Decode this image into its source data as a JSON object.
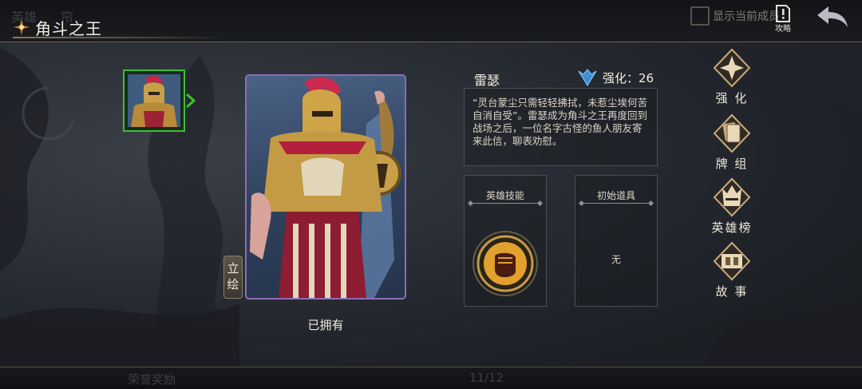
{
  "header": {
    "title": "角斗之王",
    "ghost_tabs": [
      "英雄",
      "帘"
    ],
    "show_current_label": "显示当前成员",
    "guide_label": "攻略"
  },
  "hero": {
    "name": "雷瑟",
    "enhance_label": "强化：26",
    "description": "“灵台蒙尘只需轻轻拂拭，未惹尘埃何苦自消自受”。雷瑟成为角斗之王再度回到战场之后，一位名字古怪的鱼人朋友寄来此信，聊表劝慰。",
    "portrait_tab": "立绘",
    "owned_label": "已拥有"
  },
  "panels": {
    "skill_title": "英雄技能",
    "item_title": "初始道具",
    "item_value": "无"
  },
  "menu": [
    {
      "label": "强 化",
      "icon": "enhance-icon"
    },
    {
      "label": "牌 组",
      "icon": "card-deck-icon"
    },
    {
      "label": "英雄榜",
      "icon": "hero-ranking-icon"
    },
    {
      "label": "故 事",
      "icon": "story-icon"
    }
  ],
  "footer": {
    "ghost_reward": "荣誉奖励",
    "page_indicator": "11/12"
  },
  "colors": {
    "selected_border": "#3fbf35",
    "portrait_border": "#8d6db5",
    "gold_accent": "#c9a04a"
  }
}
